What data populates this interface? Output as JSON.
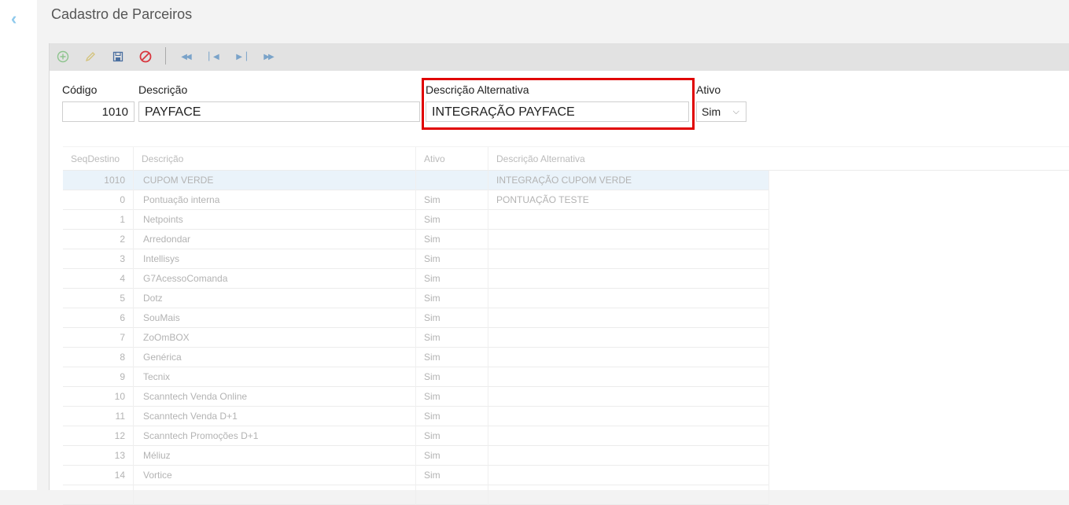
{
  "page": {
    "title": "Cadastro de Parceiros"
  },
  "form": {
    "codigo_label": "Código",
    "codigo_value": "1010",
    "descricao_label": "Descrição",
    "descricao_value": "PAYFACE",
    "desc_alt_label": "Descrição Alternativa",
    "desc_alt_value": "INTEGRAÇÃO PAYFACE",
    "ativo_label": "Ativo",
    "ativo_value": "Sim"
  },
  "grid": {
    "headers": [
      "SeqDestino",
      "Descrição",
      "Ativo",
      "Descrição Alternativa"
    ],
    "rows": [
      [
        "1010",
        "CUPOM VERDE",
        "",
        "INTEGRAÇÃO CUPOM VERDE"
      ],
      [
        "0",
        "Pontuação interna",
        "Sim",
        "PONTUAÇÃO TESTE"
      ],
      [
        "1",
        "Netpoints",
        "Sim",
        ""
      ],
      [
        "2",
        "Arredondar",
        "Sim",
        ""
      ],
      [
        "3",
        "Intellisys",
        "Sim",
        ""
      ],
      [
        "4",
        "G7AcessoComanda",
        "Sim",
        ""
      ],
      [
        "5",
        "Dotz",
        "Sim",
        ""
      ],
      [
        "6",
        "SouMais",
        "Sim",
        ""
      ],
      [
        "7",
        "ZoOmBOX",
        "Sim",
        ""
      ],
      [
        "8",
        "Genérica",
        "Sim",
        ""
      ],
      [
        "9",
        "Tecnix",
        "Sim",
        ""
      ],
      [
        "10",
        "Scanntech Venda Online",
        "Sim",
        ""
      ],
      [
        "11",
        "Scanntech Venda D+1",
        "Sim",
        ""
      ],
      [
        "12",
        "Scanntech Promoções D+1",
        "Sim",
        ""
      ],
      [
        "13",
        "Méliuz",
        "Sim",
        ""
      ],
      [
        "14",
        "Vortice",
        "Sim",
        ""
      ],
      [
        "",
        "",
        "",
        ""
      ]
    ]
  },
  "colors": {
    "highlight": "#e00000",
    "toolbar": "#e2e2e2",
    "selected_row": "#eaf3fa"
  }
}
